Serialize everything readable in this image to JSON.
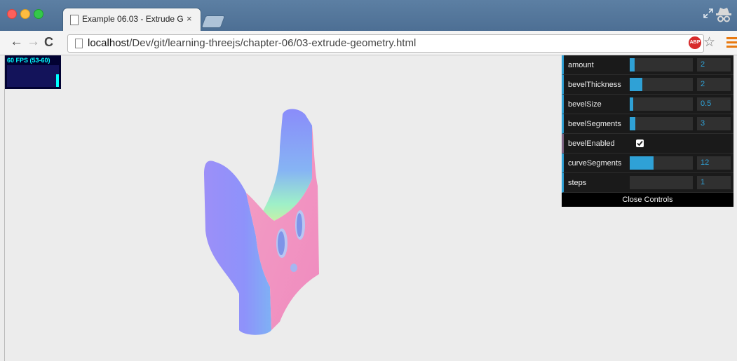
{
  "browser": {
    "tab_title": "Example 06.03 - Extrude G",
    "tab_close": "×",
    "url_host": "localhost",
    "url_path": "/Dev/git/learning-threejs/chapter-06/03-extrude-geometry.html",
    "back_icon": "arrow-left-icon",
    "forward_icon": "arrow-right-icon",
    "reload_icon": "reload-icon",
    "adblock_label": "ABP",
    "menu_color": "#e8790f"
  },
  "stats": {
    "fps_label": "60 FPS (53-60)",
    "fps_color": "#00ffff",
    "background": "#020232"
  },
  "gui": {
    "accent": "#2fa1d6",
    "controls": [
      {
        "label": "amount",
        "value": "2",
        "fill": 0.08
      },
      {
        "label": "bevelThickness",
        "value": "2",
        "fill": 0.2
      },
      {
        "label": "bevelSize",
        "value": "0.5",
        "fill": 0.05
      },
      {
        "label": "bevelSegments",
        "value": "3",
        "fill": 0.09
      },
      {
        "label": "bevelEnabled",
        "checked": true
      },
      {
        "label": "curveSegments",
        "value": "12",
        "fill": 0.38
      },
      {
        "label": "steps",
        "value": "1",
        "fill": 0.0
      }
    ],
    "close_label": "Close Controls"
  },
  "scene": {
    "background": "#ececec",
    "side_color": "#8f8cf9",
    "face_color": "#f597c3"
  }
}
